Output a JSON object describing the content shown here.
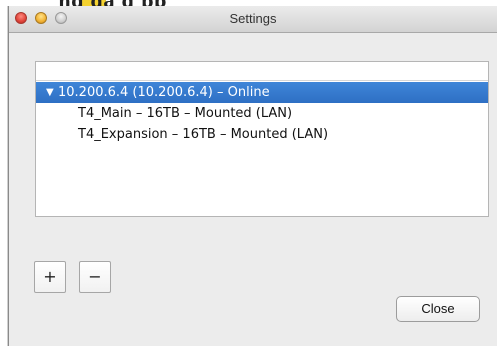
{
  "window": {
    "title": "Settings"
  },
  "background": {
    "top_text": "ng                    ga g  pp"
  },
  "list": {
    "rows": [
      {
        "disclosure": "▼",
        "label": "10.200.6.4 (10.200.6.4) – Online",
        "selected": true
      },
      {
        "label": "T4_Main – 16TB – Mounted (LAN)",
        "selected": false
      },
      {
        "label": "T4_Expansion – 16TB – Mounted (LAN)",
        "selected": false
      }
    ]
  },
  "buttons": {
    "add": "+",
    "remove": "−",
    "close": "Close"
  },
  "colors": {
    "selection": "#3478d2",
    "window_bg": "#ececec"
  }
}
